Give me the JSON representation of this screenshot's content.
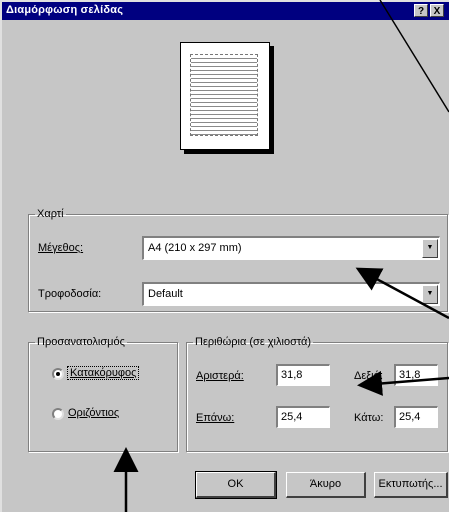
{
  "window": {
    "title": "Διαμόρφωση σελίδας",
    "help_button": "?",
    "close_button": "X"
  },
  "paper": {
    "group_label": "Χαρτί",
    "size_label": "Μέγεθος:",
    "size_value": "A4 (210 x 297 mm)",
    "source_label": "Τροφοδοσία:",
    "source_value": "Default"
  },
  "orientation": {
    "group_label": "Προσανατολισμός",
    "portrait_label": "Κατακόρυφος",
    "landscape_label": "Οριζόντιος",
    "selected": "portrait"
  },
  "margins": {
    "group_label": "Περιθώρια (σε χιλιοστά)",
    "left_label": "Αριστερά:",
    "left_value": "31,8",
    "right_label": "Δεξιά:",
    "right_value": "31,8",
    "top_label": "Επάνω:",
    "top_value": "25,4",
    "bottom_label": "Κάτω:",
    "bottom_value": "25,4"
  },
  "buttons": {
    "ok": "OK",
    "cancel": "Άκυρο",
    "printer": "Εκτυπωτής..."
  },
  "icons": {
    "combo_arrow": "down-triangle",
    "annotation": "black-arrow"
  }
}
